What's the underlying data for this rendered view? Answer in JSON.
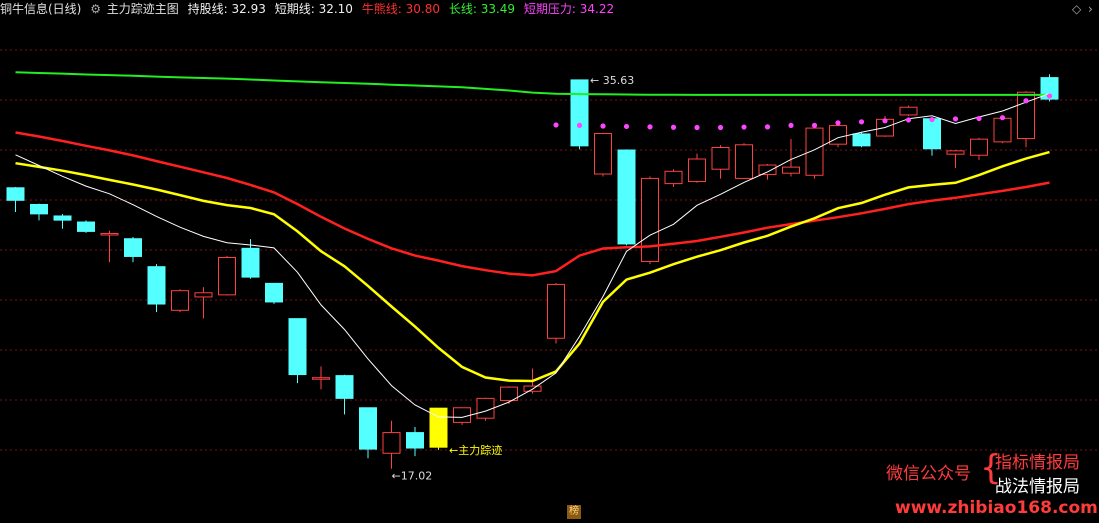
{
  "header": {
    "title": "铜牛信息(日线)",
    "indicator_name": "主力踪迹主图",
    "hold_label": "持股线:",
    "hold_value": "32.93",
    "short_label": "短期线:",
    "short_value": "32.10",
    "bull_label": "牛熊线:",
    "bull_value": "30.80",
    "long_label": "长线:",
    "long_value": "33.49",
    "resist_label": "短期压力:",
    "resist_value": "34.22"
  },
  "icons": {
    "top_left": "gear-icon",
    "top_right": "diamond-icon",
    "top_right2": "chevron-icon"
  },
  "watermark": {
    "wechat": "微信公众号",
    "item1": "指标情报局",
    "item2": "战法情报局",
    "url": "www.zhibiao168.com"
  },
  "bottom_mark": "榜",
  "colors": {
    "up": "#ff4040",
    "down": "#54ffff",
    "hold": "#ffff00",
    "short": "#ffffff",
    "bull": "#ff2020",
    "long": "#22ee22",
    "resist": "#ff44ff",
    "grid": "#7a1010"
  },
  "chart_data": {
    "type": "candlestick",
    "y_range": [
      15.5,
      38.5
    ],
    "grid": "dashed horizontal",
    "annotations": {
      "high_label": "35.63",
      "low_label": "17.02",
      "marker_label": "主力踪迹"
    },
    "candles": [
      {
        "o": 30.46,
        "c": 29.86,
        "h": 30.5,
        "l": 29.3
      },
      {
        "o": 29.66,
        "c": 29.21,
        "h": 29.7,
        "l": 28.9
      },
      {
        "o": 29.11,
        "c": 28.91,
        "h": 29.2,
        "l": 28.5
      },
      {
        "o": 28.82,
        "c": 28.37,
        "h": 28.9,
        "l": 28.3
      },
      {
        "o": 28.22,
        "c": 28.27,
        "h": 28.4,
        "l": 26.9
      },
      {
        "o": 28.02,
        "c": 27.17,
        "h": 28.1,
        "l": 26.9
      },
      {
        "o": 26.68,
        "c": 24.89,
        "h": 26.8,
        "l": 24.5
      },
      {
        "o": 24.59,
        "c": 25.53,
        "h": 25.6,
        "l": 24.5
      },
      {
        "o": 25.23,
        "c": 25.43,
        "h": 25.7,
        "l": 24.2
      },
      {
        "o": 25.33,
        "c": 27.12,
        "h": 27.2,
        "l": 25.3
      },
      {
        "o": 27.56,
        "c": 26.18,
        "h": 28.0,
        "l": 26.1
      },
      {
        "o": 25.88,
        "c": 24.99,
        "h": 25.9,
        "l": 24.9
      },
      {
        "o": 24.19,
        "c": 21.51,
        "h": 24.2,
        "l": 21.1
      },
      {
        "o": 21.36,
        "c": 21.36,
        "h": 21.9,
        "l": 20.8
      },
      {
        "o": 21.46,
        "c": 20.37,
        "h": 21.5,
        "l": 19.6
      },
      {
        "o": 19.92,
        "c": 17.94,
        "h": 19.9,
        "l": 17.5
      },
      {
        "o": 17.74,
        "c": 18.73,
        "h": 19.3,
        "l": 17.0
      },
      {
        "o": 18.73,
        "c": 17.99,
        "h": 19.0,
        "l": 17.6
      },
      {
        "o": 18.03,
        "c": 19.9,
        "h": 19.9,
        "l": 17.9,
        "highlight": true
      },
      {
        "o": 19.22,
        "c": 19.92,
        "h": 19.92,
        "l": 19.1
      },
      {
        "o": 19.42,
        "c": 20.37,
        "h": 20.4,
        "l": 19.3
      },
      {
        "o": 20.27,
        "c": 20.91,
        "h": 20.95,
        "l": 20.1
      },
      {
        "o": 20.71,
        "c": 20.96,
        "h": 21.8,
        "l": 20.6
      },
      {
        "o": 23.25,
        "c": 25.83,
        "h": 25.9,
        "l": 23.0
      },
      {
        "o": 35.63,
        "c": 32.47,
        "h": 35.63,
        "l": 32.3
      },
      {
        "o": 31.12,
        "c": 33.06,
        "h": 33.1,
        "l": 31.0
      },
      {
        "o": 32.27,
        "c": 27.77,
        "h": 32.3,
        "l": 27.7
      },
      {
        "o": 26.93,
        "c": 30.91,
        "h": 31.0,
        "l": 26.8
      },
      {
        "o": 30.66,
        "c": 31.25,
        "h": 31.35,
        "l": 30.5
      },
      {
        "o": 30.76,
        "c": 31.84,
        "h": 32.1,
        "l": 30.7
      },
      {
        "o": 31.35,
        "c": 32.39,
        "h": 32.5,
        "l": 30.9
      },
      {
        "o": 30.91,
        "c": 32.52,
        "h": 32.6,
        "l": 30.9
      },
      {
        "o": 31.1,
        "c": 31.55,
        "h": 31.6,
        "l": 30.85
      },
      {
        "o": 31.16,
        "c": 31.45,
        "h": 32.8,
        "l": 31.0
      },
      {
        "o": 31.06,
        "c": 33.32,
        "h": 33.4,
        "l": 30.9
      },
      {
        "o": 32.55,
        "c": 33.44,
        "h": 33.5,
        "l": 32.4
      },
      {
        "o": 33.04,
        "c": 32.47,
        "h": 33.1,
        "l": 32.4
      },
      {
        "o": 32.94,
        "c": 33.74,
        "h": 33.9,
        "l": 32.9
      },
      {
        "o": 33.95,
        "c": 34.32,
        "h": 34.4,
        "l": 33.9
      },
      {
        "o": 33.77,
        "c": 32.33,
        "h": 33.8,
        "l": 32.0
      },
      {
        "o": 32.07,
        "c": 32.23,
        "h": 32.27,
        "l": 31.4
      },
      {
        "o": 32.02,
        "c": 32.79,
        "h": 32.85,
        "l": 31.8
      },
      {
        "o": 32.66,
        "c": 33.79,
        "h": 33.9,
        "l": 32.6
      },
      {
        "o": 32.82,
        "c": 35.04,
        "h": 35.1,
        "l": 32.4
      },
      {
        "o": 35.74,
        "c": 34.71,
        "h": 35.9,
        "l": 34.6
      }
    ],
    "series": [
      {
        "name": "长线",
        "values": [
          36.0,
          35.96,
          35.93,
          35.89,
          35.86,
          35.83,
          35.79,
          35.75,
          35.72,
          35.69,
          35.65,
          35.6,
          35.56,
          35.52,
          35.48,
          35.45,
          35.4,
          35.36,
          35.32,
          35.28,
          35.2,
          35.12,
          35.02,
          34.97,
          34.95,
          34.94,
          34.93,
          34.92,
          34.92,
          34.91,
          34.91,
          34.91,
          34.91,
          34.91,
          34.91,
          34.91,
          34.91,
          34.91,
          34.91,
          34.91,
          34.91,
          34.91,
          34.91,
          34.91,
          34.91
        ]
      },
      {
        "name": "牛熊线",
        "values": [
          33.11,
          32.92,
          32.7,
          32.47,
          32.25,
          32.01,
          31.74,
          31.47,
          31.2,
          30.93,
          30.6,
          30.24,
          29.68,
          29.07,
          28.51,
          28.01,
          27.56,
          27.21,
          26.97,
          26.71,
          26.51,
          26.35,
          26.26,
          26.47,
          27.21,
          27.55,
          27.61,
          27.65,
          27.78,
          27.91,
          28.11,
          28.32,
          28.55,
          28.72,
          28.89,
          29.05,
          29.24,
          29.45,
          29.68,
          29.84,
          29.98,
          30.15,
          30.31,
          30.5,
          30.71
        ]
      },
      {
        "name": "持股线",
        "values": [
          31.64,
          31.46,
          31.28,
          31.07,
          30.84,
          30.62,
          30.38,
          30.11,
          29.83,
          29.63,
          29.49,
          29.19,
          28.37,
          27.42,
          26.7,
          25.76,
          24.77,
          23.81,
          22.79,
          21.88,
          21.37,
          21.22,
          21.2,
          21.66,
          23.0,
          24.99,
          26.06,
          26.39,
          26.8,
          27.16,
          27.47,
          27.84,
          28.16,
          28.6,
          29.0,
          29.48,
          29.73,
          30.13,
          30.48,
          30.6,
          30.7,
          31.07,
          31.49,
          31.86,
          32.17
        ]
      },
      {
        "name": "短期线",
        "values": [
          32.04,
          31.53,
          31.01,
          30.54,
          30.17,
          29.65,
          29.09,
          28.57,
          28.13,
          27.83,
          27.72,
          27.58,
          26.41,
          24.85,
          23.67,
          22.26,
          20.98,
          20.05,
          19.48,
          19.46,
          19.76,
          20.19,
          20.81,
          21.59,
          23.34,
          25.25,
          27.41,
          28.19,
          28.71,
          29.62,
          30.15,
          30.72,
          31.22,
          31.82,
          32.28,
          32.86,
          33.12,
          33.35,
          33.77,
          33.91,
          33.54,
          33.85,
          34.14,
          34.56,
          34.98
        ]
      }
    ],
    "resist_dots": [
      {
        "i": 23,
        "v": 33.47
      },
      {
        "i": 24,
        "v": 33.45
      },
      {
        "i": 25,
        "v": 33.42
      },
      {
        "i": 26,
        "v": 33.4
      },
      {
        "i": 27,
        "v": 33.38
      },
      {
        "i": 28,
        "v": 33.36
      },
      {
        "i": 29,
        "v": 33.35
      },
      {
        "i": 30,
        "v": 33.35
      },
      {
        "i": 31,
        "v": 33.37
      },
      {
        "i": 32,
        "v": 33.38
      },
      {
        "i": 33,
        "v": 33.45
      },
      {
        "i": 34,
        "v": 33.45
      },
      {
        "i": 35,
        "v": 33.57
      },
      {
        "i": 36,
        "v": 33.62
      },
      {
        "i": 37,
        "v": 33.67
      },
      {
        "i": 38,
        "v": 33.71
      },
      {
        "i": 39,
        "v": 33.73
      },
      {
        "i": 40,
        "v": 33.76
      },
      {
        "i": 41,
        "v": 33.78
      },
      {
        "i": 42,
        "v": 33.82
      },
      {
        "i": 43,
        "v": 34.63
      },
      {
        "i": 44,
        "v": 34.86
      }
    ]
  }
}
